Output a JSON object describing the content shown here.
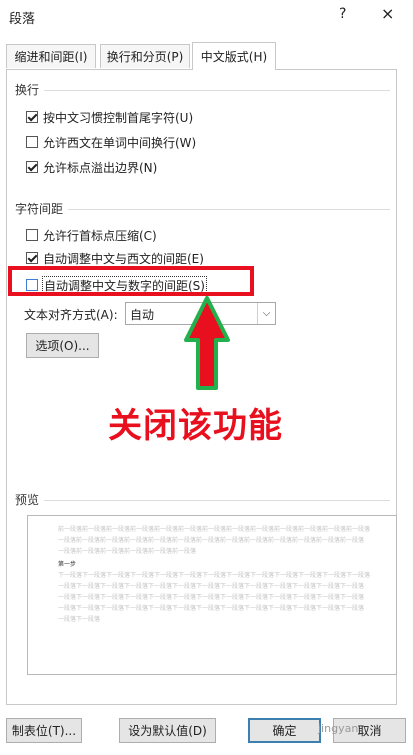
{
  "title": "段落",
  "title_buttons": {
    "help": "?",
    "close": "×"
  },
  "tabs": [
    {
      "label": "缩进和间距(I)"
    },
    {
      "label": "换行和分页(P)"
    },
    {
      "label": "中文版式(H)"
    }
  ],
  "sections": {
    "wrap": {
      "label": "换行",
      "options": [
        {
          "label": "按中文习惯控制首尾字符(U)",
          "checked": true
        },
        {
          "label": "允许西文在单词中间换行(W)",
          "checked": false
        },
        {
          "label": "允许标点溢出边界(N)",
          "checked": true
        }
      ]
    },
    "spacing": {
      "label": "字符间距",
      "options": [
        {
          "label": "允许行首标点压缩(C)",
          "checked": false
        },
        {
          "label": "自动调整中文与西文的间距(E)",
          "checked": true
        },
        {
          "label": "自动调整中文与数字的间距(S)",
          "checked": false
        }
      ]
    }
  },
  "alignment": {
    "label": "文本对齐方式(A):",
    "value": "自动"
  },
  "options_button": "选项(O)...",
  "annotation": "关闭该功能",
  "preview": {
    "label": "预览",
    "prev_lines": [
      "前一段落前一段落前一段落前一段落前一段落前一段落前一段落前一段落前一段落前一段落前一段落前一段落前一段落",
      "一段落前一段落前一段落前一段落前一段落前一段落前一段落前一段落前一段落前一段落前一段落前一段落前一段落",
      "一段落前一段落前一段落前一段落前一段落前一段落"
    ],
    "sample": "第一步",
    "next_lines": [
      "下一段落下一段落下一段落下一段落下一段落下一段落下一段落下一段落下一段落下一段落下一段落下一段落下一段落",
      "一段落下一段落下一段落下一段落下一段落下一段落下一段落下一段落下一段落下一段落下一段落下一段落下一段落",
      "一段落下一段落下一段落下一段落下一段落下一段落下一段落下一段落下一段落下一段落下一段落下一段落下一段落",
      "一段落下一段落下一段落下一段落下一段落下一段落下一段落下一段落下一段落下一段落下一段落下一段落下一段落",
      "一段落下一段落"
    ]
  },
  "footer": {
    "tab_stops": "制表位(T)...",
    "set_default": "设为默认值(D)",
    "ok": "确定",
    "cancel": "取消"
  },
  "watermark": "jingyan",
  "colors": {
    "highlight": "#e8101e",
    "arrow_green": "#22b14c"
  }
}
